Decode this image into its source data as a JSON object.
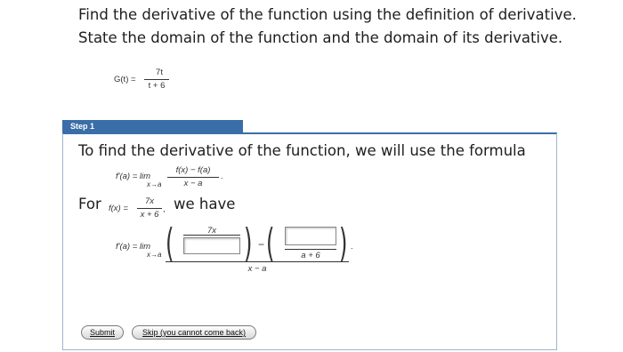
{
  "problem": {
    "statement": "Find the derivative of the function using the definition of derivative. State the domain of the function and the domain of its derivative.",
    "function_lhs": "G(t) =",
    "function_num": "7t",
    "function_den": "t + 6"
  },
  "step": {
    "tab_label": "Step 1",
    "intro": "To find the derivative of the function, we will use the formula",
    "formula_lhs": "f'(a) = lim",
    "formula_sub": "x→a",
    "formula_num": "f(x) − f(a)",
    "formula_den": "x − a",
    "formula_end": ".",
    "for_label": "For",
    "fx_lhs": "f(x) =",
    "fx_num": "7x",
    "fx_den": "x + 6",
    "fx_comma": ",",
    "we_have": "we have",
    "work_lhs": "f'(a) = lim",
    "work_sub": "x→a",
    "work_num1": "7x",
    "work_minus": "−",
    "work_den2": "a + 6",
    "work_den": "x − a",
    "work_end": "."
  },
  "buttons": {
    "submit": "Submit",
    "skip": "Skip (you cannot come back)"
  }
}
